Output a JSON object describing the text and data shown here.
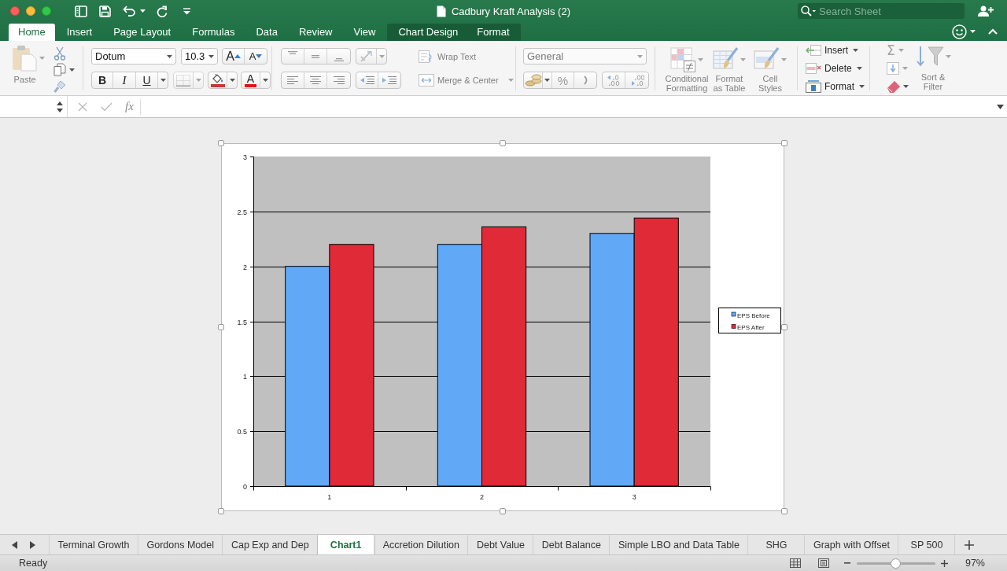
{
  "window": {
    "title": "Cadbury Kraft Analysis (2)"
  },
  "search": {
    "placeholder": "Search Sheet"
  },
  "ribbon_tabs": [
    {
      "label": "Home",
      "selected": true,
      "kind": "main"
    },
    {
      "label": "Insert",
      "selected": false,
      "kind": "main"
    },
    {
      "label": "Page Layout",
      "selected": false,
      "kind": "main"
    },
    {
      "label": "Formulas",
      "selected": false,
      "kind": "main"
    },
    {
      "label": "Data",
      "selected": false,
      "kind": "main"
    },
    {
      "label": "Review",
      "selected": false,
      "kind": "main"
    },
    {
      "label": "View",
      "selected": false,
      "kind": "main"
    },
    {
      "label": "Chart Design",
      "selected": false,
      "kind": "contextual"
    },
    {
      "label": "Format",
      "selected": false,
      "kind": "contextual"
    }
  ],
  "ribbon": {
    "clipboard": {
      "paste": {
        "label": "Paste",
        "disabled": true
      }
    },
    "font": {
      "name": "Dotum",
      "size": "10.3",
      "grow": "A",
      "shrink": "A",
      "bold": "B",
      "italic": "I",
      "underline": "U",
      "font_color": "A"
    },
    "alignment": {
      "wrap_text": {
        "label": "Wrap Text",
        "disabled": true
      },
      "merge": {
        "label": "Merge & Center",
        "disabled": true
      }
    },
    "number": {
      "format": {
        "value": "General",
        "disabled": true
      },
      "percent": "%"
    },
    "styles": [
      {
        "label": "Conditional Formatting",
        "disabled": true
      },
      {
        "label": "Format as Table",
        "disabled": true
      },
      {
        "label": "Cell Styles",
        "disabled": true
      }
    ],
    "cells": [
      {
        "label": "Insert",
        "disabled": false
      },
      {
        "label": "Delete",
        "disabled": false
      },
      {
        "label": "Format",
        "disabled": false
      }
    ],
    "editing": {
      "sum": "Σ",
      "sort_filter": {
        "label": "Sort & Filter",
        "disabled": true
      }
    }
  },
  "formula_bar": {
    "function_label": "fx"
  },
  "chart": {
    "chart_data": {
      "type": "bar",
      "categories": [
        "1",
        "2",
        "3"
      ],
      "series": [
        {
          "name": "EPS Before",
          "color": "#61a9f6",
          "values": [
            2,
            2.2,
            2.3
          ]
        },
        {
          "name": "EPS After",
          "color": "#e02a37",
          "values": [
            2.2,
            2.36,
            2.44
          ]
        }
      ],
      "ylim": [
        0,
        3
      ],
      "yticks": [
        0,
        0.5,
        1,
        1.5,
        2,
        2.5,
        3
      ],
      "grid": true,
      "legend": true
    }
  },
  "sheet_tabs": [
    {
      "label": "Terminal Growth",
      "selected": false
    },
    {
      "label": "Gordons Model",
      "selected": false
    },
    {
      "label": "Cap Exp and Dep",
      "selected": false
    },
    {
      "label": "Chart1",
      "selected": true
    },
    {
      "label": "Accretion Dilution",
      "selected": false
    },
    {
      "label": "Debt Value",
      "selected": false
    },
    {
      "label": "Debt Balance",
      "selected": false
    },
    {
      "label": "Simple LBO and Data Table",
      "selected": false
    },
    {
      "label": "SHG",
      "selected": false
    },
    {
      "label": "Graph with Offset",
      "selected": false
    },
    {
      "label": "SP 500",
      "selected": false
    }
  ],
  "status_bar": {
    "status": "Ready",
    "zoom_slider": {
      "level": 0.49
    },
    "zoom": "97%"
  }
}
